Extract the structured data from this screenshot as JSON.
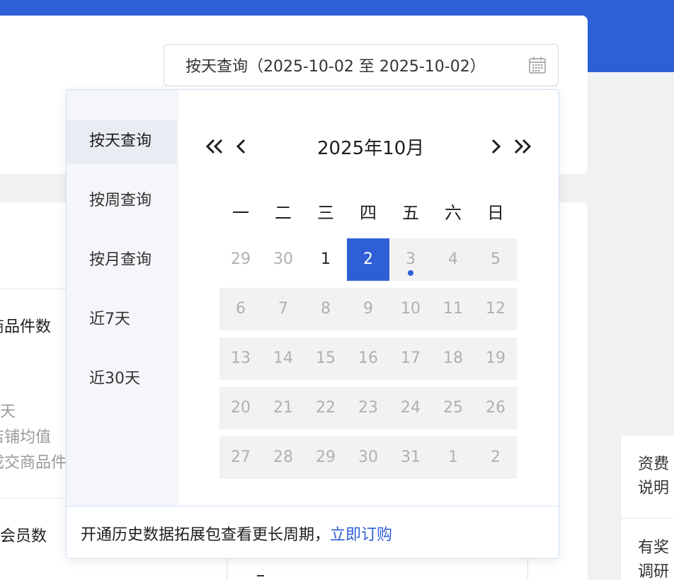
{
  "background": {
    "labels": [
      "商品件数",
      "一天",
      "店铺均值",
      "成交商品件",
      "交会员数"
    ],
    "right_panel": [
      "资费",
      "说明",
      "有奖",
      "调研"
    ],
    "dash": "-"
  },
  "date_input": {
    "value": "按天查询（2025-10-02 至 2025-10-02）",
    "icon": "calendar-icon"
  },
  "picker": {
    "sidebar": [
      "按天查询",
      "按周查询",
      "按月查询",
      "近7天",
      "近30天"
    ],
    "active_index": 0,
    "month_title": "2025年10月",
    "weekdays": [
      "一",
      "二",
      "三",
      "四",
      "五",
      "六",
      "日"
    ],
    "weeks": [
      [
        "29",
        "30",
        "1",
        "2",
        "3",
        "4",
        "5"
      ],
      [
        "6",
        "7",
        "8",
        "9",
        "10",
        "11",
        "12"
      ],
      [
        "13",
        "14",
        "15",
        "16",
        "17",
        "18",
        "19"
      ],
      [
        "20",
        "21",
        "22",
        "23",
        "24",
        "25",
        "26"
      ],
      [
        "27",
        "28",
        "29",
        "30",
        "31",
        "1",
        "2"
      ]
    ],
    "selected": "2",
    "today": "3",
    "footer_text": "开通历史数据拓展包查看更长周期，",
    "footer_link": "立即订购"
  },
  "colors": {
    "accent": "#2f5fd6",
    "disabled_bg": "#f2f2f2",
    "disabled_text": "#b0b0b0"
  }
}
